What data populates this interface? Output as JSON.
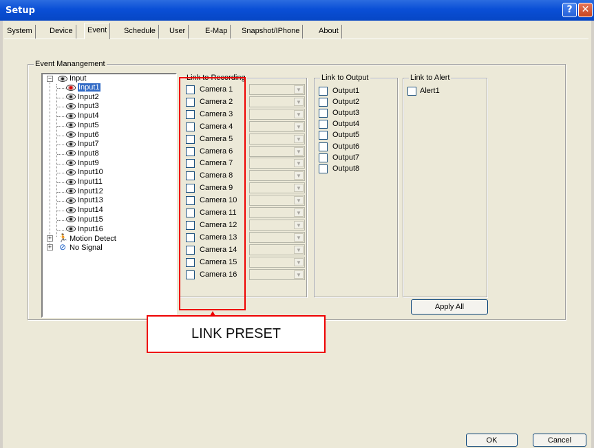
{
  "window": {
    "title": "Setup",
    "help": "?",
    "close": "✕"
  },
  "tabs": [
    "System",
    "Device",
    "Event",
    "Schedule",
    "User",
    "E-Map",
    "Snapshot/IPhone",
    "About"
  ],
  "active_tab": "Event",
  "event_management": {
    "title": "Event Manangement",
    "tree": {
      "root": "Input",
      "inputs": [
        "Input1",
        "Input2",
        "Input3",
        "Input4",
        "Input5",
        "Input6",
        "Input7",
        "Input8",
        "Input9",
        "Input10",
        "Input11",
        "Input12",
        "Input13",
        "Input14",
        "Input15",
        "Input16"
      ],
      "selected": "Input1",
      "motion": "Motion Detect",
      "nosignal": "No Signal",
      "expand_minus": "−",
      "expand_plus": "+"
    },
    "link_to_recording": {
      "title": "Link to Recording",
      "cameras": [
        "Camera 1",
        "Camera 2",
        "Camera 3",
        "Camera 4",
        "Camera 5",
        "Camera 6",
        "Camera 7",
        "Camera 8",
        "Camera 9",
        "Camera 10",
        "Camera 11",
        "Camera 12",
        "Camera 13",
        "Camera 14",
        "Camera 15",
        "Camera 16"
      ]
    },
    "link_to_output": {
      "title": "Link to Output",
      "outputs": [
        "Output1",
        "Output2",
        "Output3",
        "Output4",
        "Output5",
        "Output6",
        "Output7",
        "Output8"
      ]
    },
    "link_to_alert": {
      "title": "Link to Alert",
      "alerts": [
        "Alert1"
      ]
    },
    "apply_all": "Apply All"
  },
  "annotation": {
    "label": "LINK PRESET",
    "color": "#ee0000"
  },
  "footer": {
    "ok": "OK",
    "cancel": "Cancel"
  },
  "colors": {
    "title_bar": "#0a4fd6",
    "selection": "#316ac5",
    "client_bg": "#ece9d8"
  }
}
